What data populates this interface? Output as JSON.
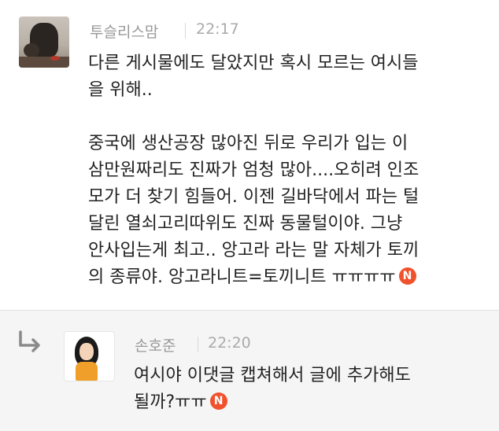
{
  "comments": [
    {
      "author": "투슬리스맘",
      "time": "22:17",
      "text": "다른 게시물에도 달았지만 혹시 모르는 여시들\n을 위해..\n\n 중국에 생산공장 많아진 뒤로 우리가 입는 이\n삼만원짜리도 진짜가 엄청 많아....오히려 인조\n모가 더 찾기 힘들어. 이젠 길바닥에서 파는 털\n달린 열쇠고리따위도 진짜 동물털이야. 그냥\n안사입는게 최고.. 앙고라 라는 말 자체가 토끼\n의 종류야. 앙고라니트=토끼니트 ㅠㅠㅠㅠ",
      "badge": "N"
    },
    {
      "author": "손호준",
      "time": "22:20",
      "text": "여시야 이댓글 캡쳐해서 글에 추가해도\n될까?ㅠㅠ",
      "badge": "N",
      "is_reply": true
    }
  ],
  "icons": {
    "reply_arrow": "reply-arrow-icon",
    "new_badge": "new-badge-icon"
  },
  "colors": {
    "badge": "#f0522d",
    "meta_text": "#999999",
    "reply_background": "#f5f5f5"
  }
}
